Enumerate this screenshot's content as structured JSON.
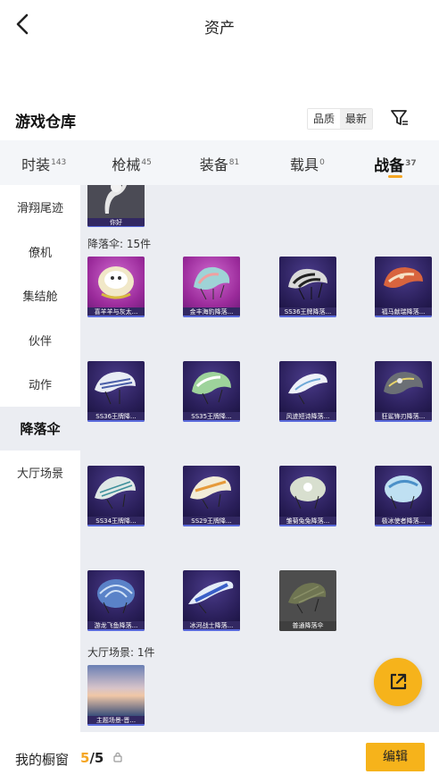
{
  "header": {
    "title": "资产"
  },
  "section": {
    "title": "游戏仓库",
    "sort_quality": "品质",
    "sort_newest": "最新"
  },
  "tabs": [
    {
      "label": "时装",
      "count": "143"
    },
    {
      "label": "枪械",
      "count": "45"
    },
    {
      "label": "装备",
      "count": "81"
    },
    {
      "label": "载具",
      "count": "0"
    },
    {
      "label": "战备",
      "count": "37"
    }
  ],
  "sidebar": [
    {
      "label": "滑翔尾迹"
    },
    {
      "label": "僚机"
    },
    {
      "label": "集结舱"
    },
    {
      "label": "伙伴"
    },
    {
      "label": "动作"
    },
    {
      "label": "降落伞"
    },
    {
      "label": "大厅场景"
    }
  ],
  "top_item": {
    "name": "你好"
  },
  "parachutes": {
    "label": "降落伞: 15件",
    "items": [
      {
        "name": "喜羊羊与灰太..."
      },
      {
        "name": "金丰海豹降落..."
      },
      {
        "name": "SS36王牌降落..."
      },
      {
        "name": "福马献瑞降落..."
      },
      {
        "name": "SS36王牌降..."
      },
      {
        "name": "SS35王牌降..."
      },
      {
        "name": "风迹短诗降落..."
      },
      {
        "name": "狂鲨锋刃降落..."
      },
      {
        "name": "SS34王牌降..."
      },
      {
        "name": "SS29王牌降..."
      },
      {
        "name": "雏菊兔兔降落..."
      },
      {
        "name": "极冰使者降落..."
      },
      {
        "name": "游龙飞鱼降落..."
      },
      {
        "name": "冰河战士降落..."
      },
      {
        "name": "普通降落伞"
      }
    ]
  },
  "lobby": {
    "label": "大厅场景: 1件",
    "items": [
      {
        "name": "主题场景-晋..."
      }
    ]
  },
  "bottombar": {
    "label": "我的橱窗",
    "count_current": "5",
    "count_total": "/5",
    "edit_label": "编辑"
  },
  "colors": {
    "accent": "#f6b31b",
    "tab_underline": "#f5a623",
    "content_bg": "#ebedf2"
  }
}
